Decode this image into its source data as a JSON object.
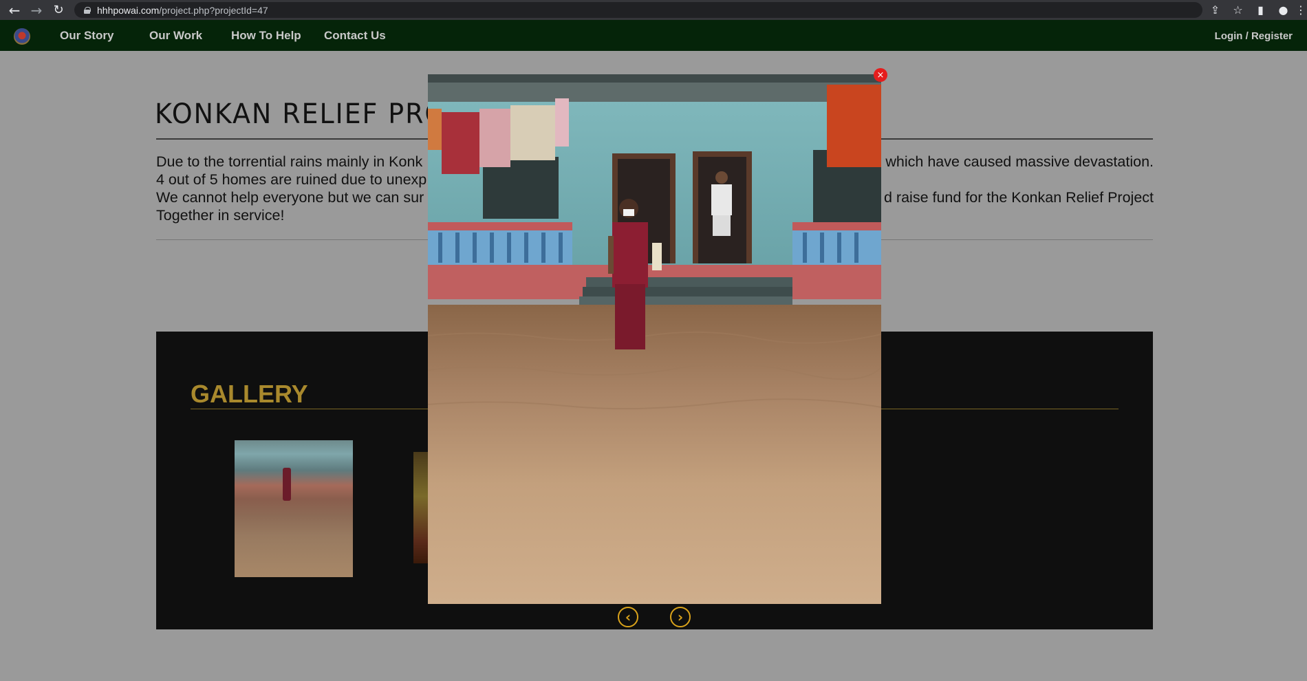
{
  "browser": {
    "url_host": "hhhpowai.com",
    "url_path": "/project.php?projectId=47",
    "back_icon": "arrow-left-icon",
    "forward_icon": "arrow-right-icon",
    "reload_icon": "reload-icon",
    "share_icon": "share-icon",
    "bookmark_icon": "star-icon",
    "sidepanel_icon": "side-panel-icon",
    "profile_icon": "profile-icon",
    "menu_icon": "kebab-menu-icon"
  },
  "nav": {
    "items": [
      {
        "label": "Our Story"
      },
      {
        "label": "Our Work"
      },
      {
        "label": "How To Help"
      },
      {
        "label": "Contact Us"
      }
    ],
    "login": "Login / Register"
  },
  "page": {
    "title": "KONKAN RELIEF PROJE",
    "desc": {
      "line1_left": "Due to the torrential rains mainly in Konk",
      "line1_right": "which have caused massive devastation.",
      "line2_left": "4 out of 5 homes are ruined due to unexp",
      "line3_left": "We cannot help everyone but we can sur",
      "line3_right": "d raise fund for the Konkan Relief Project",
      "line4_left": "Together in service!"
    }
  },
  "gallery": {
    "title": "GALLERY"
  },
  "lightbox": {
    "close_label": "×",
    "prev_label": "‹",
    "next_label": "›"
  },
  "colors": {
    "nav_bg": "#052409",
    "gallery_bg": "#0f0f0f",
    "gallery_accent": "#a9892d",
    "arrow_accent": "#d9a21b",
    "close_red": "#e51d1d"
  }
}
